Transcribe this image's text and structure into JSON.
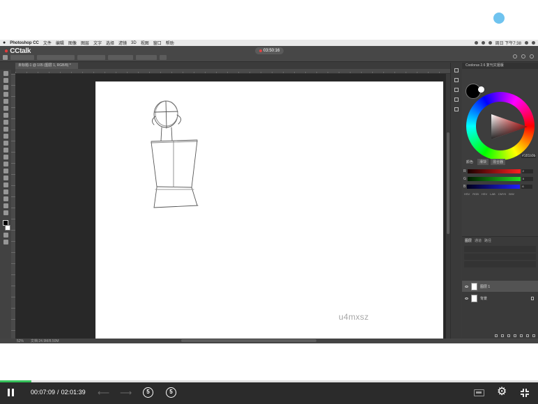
{
  "menubar": {
    "app_name": "Photoshop CC",
    "items": [
      "文件",
      "编辑",
      "图像",
      "图层",
      "文字",
      "选择",
      "滤镜",
      "3D",
      "视图",
      "窗口",
      "帮助"
    ],
    "clock": "周日 下午7:38"
  },
  "photoshop": {
    "cctalk_logo": "CCtalk",
    "recording_time": "03:50:16",
    "document_tab": "未标题-1 @ 105 (图层 1, RGB/8) *",
    "status_zoom": "52%",
    "status_doc": "文档:24.9M/8.50M",
    "color_panel_title": "Coolorus 2.6 复刊文姐版",
    "color_tabs": [
      "颜色",
      "滑块",
      "混合器"
    ],
    "hex_value": "#181b9b",
    "slider_values": [
      "2",
      "0",
      "6"
    ],
    "color_modes": [
      "HSV",
      "RGB",
      "HSV",
      "LAB",
      "CMYK",
      "B/W"
    ],
    "layer_tabs": [
      "图层",
      "通道",
      "路径"
    ],
    "layers": [
      {
        "name": "图层 1",
        "selected": true
      },
      {
        "name": "背景",
        "selected": false
      }
    ],
    "watermark": "u4mxsz"
  },
  "player": {
    "current_time": "00:07:09",
    "separator": "/",
    "total_time": "02:01:39",
    "progress_fraction": 0.0587,
    "rewind_label": "5",
    "forward_label": "5",
    "accent_color": "#35c25a"
  }
}
